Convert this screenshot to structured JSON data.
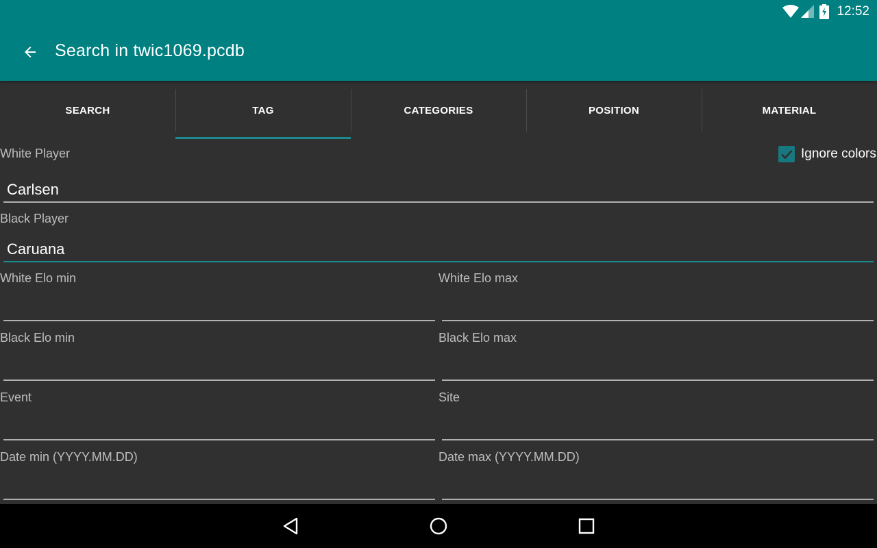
{
  "status_bar": {
    "time": "12:52",
    "icons": [
      "wifi-icon",
      "cell-signal-icon",
      "battery-charging-icon"
    ]
  },
  "app_bar": {
    "title": "Search in twic1069.pcdb",
    "back_icon": "arrow-back-icon",
    "background": "#008080"
  },
  "tabs": [
    {
      "label": "SEARCH",
      "active": false
    },
    {
      "label": "TAG",
      "active": true
    },
    {
      "label": "CATEGORIES",
      "active": false
    },
    {
      "label": "POSITION",
      "active": false
    },
    {
      "label": "MATERIAL",
      "active": false
    }
  ],
  "form": {
    "white_player": {
      "label": "White Player",
      "value": "Carlsen"
    },
    "ignore_colors": {
      "label": "Ignore colors",
      "checked": true
    },
    "black_player": {
      "label": "Black Player",
      "value": "Caruana"
    },
    "white_elo_min": {
      "label": "White Elo min",
      "value": ""
    },
    "white_elo_max": {
      "label": "White Elo max",
      "value": ""
    },
    "black_elo_min": {
      "label": "Black Elo min",
      "value": ""
    },
    "black_elo_max": {
      "label": "Black Elo max",
      "value": ""
    },
    "event": {
      "label": "Event",
      "value": ""
    },
    "site": {
      "label": "Site",
      "value": ""
    },
    "date_min": {
      "label": "Date min (YYYY.MM.DD)",
      "value": ""
    },
    "date_max": {
      "label": "Date max (YYYY.MM.DD)",
      "value": ""
    }
  },
  "nav_bar": {
    "icons": [
      "nav-back-icon",
      "nav-home-icon",
      "nav-recents-icon"
    ]
  },
  "colors": {
    "accent": "#1a8a91",
    "background": "#303030"
  }
}
